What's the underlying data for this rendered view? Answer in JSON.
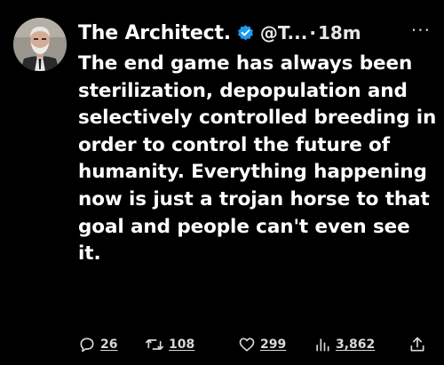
{
  "tweet": {
    "author_name": "The Architect.",
    "handle": "@T...",
    "separator": "·",
    "time": "18m",
    "more": "···",
    "text": "The end game has always been sterilization, depopulation and selectively controlled breeding in order to control the future of humanity. Everything happening now is just a trojan horse to that goal and people can't even see it.",
    "verified_icon": "verified-badge-icon",
    "verified_color": "#1d9bf0"
  },
  "actions": {
    "replies": "26",
    "retweets": "108",
    "likes": "299",
    "views": "3,862"
  },
  "colors": {
    "background": "#000000",
    "text": "#ffffff",
    "muted": "#d8d8d8"
  }
}
